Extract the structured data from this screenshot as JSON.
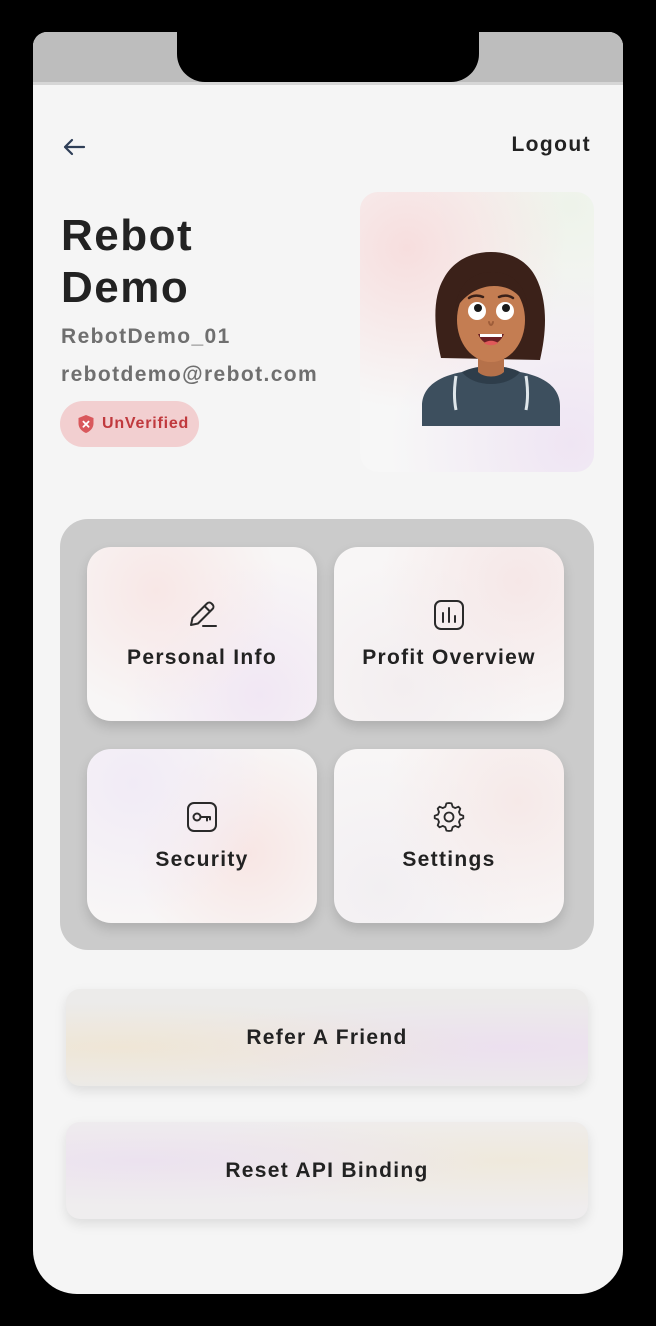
{
  "header": {
    "back_icon": "arrow-left-icon",
    "logout_label": "Logout"
  },
  "profile": {
    "first_name": "Rebot",
    "last_name": "Demo",
    "username": "RebotDemo_01",
    "email": "rebotdemo@rebot.com",
    "status_icon": "shield-x-icon",
    "status_label": "UnVerified",
    "status_color": "#c0393d"
  },
  "menu": {
    "tiles": [
      {
        "label": "Personal Info",
        "icon": "pencil-icon"
      },
      {
        "label": "Profit Overview",
        "icon": "chart-icon"
      },
      {
        "label": "Security",
        "icon": "key-icon"
      },
      {
        "label": "Settings",
        "icon": "gear-icon"
      }
    ]
  },
  "actions": {
    "refer_label": "Refer A Friend",
    "reset_label": "Reset API Binding"
  }
}
